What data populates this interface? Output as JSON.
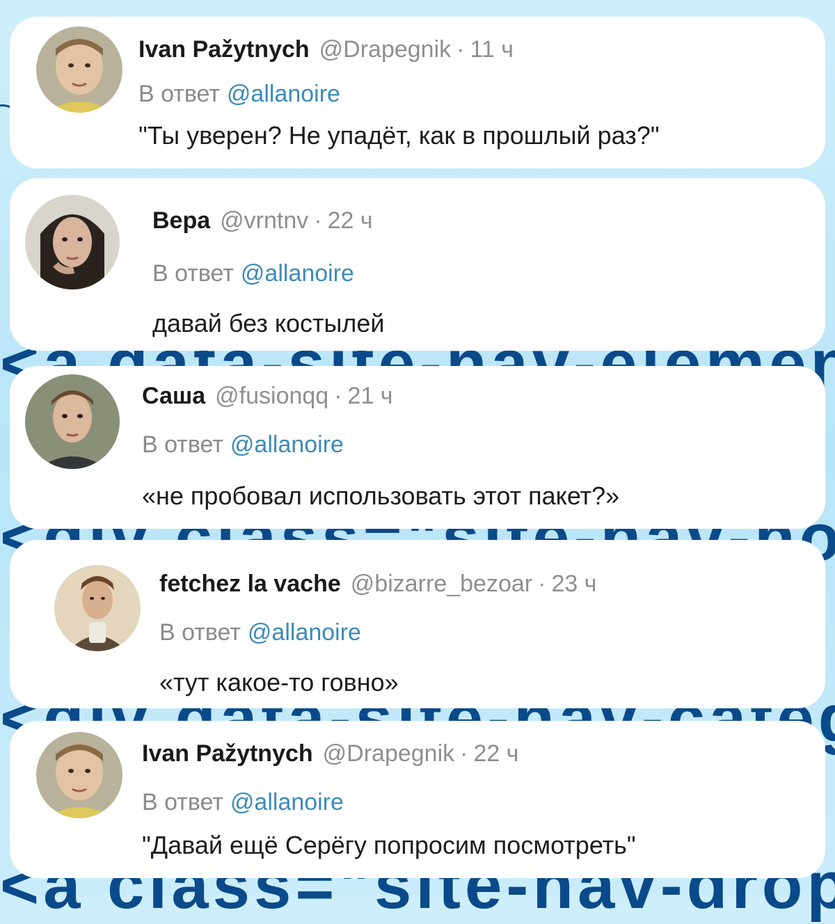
{
  "reply_prefix": "В ответ",
  "replies": [
    {
      "name": "Ivan Pažytnych",
      "handle": "@Drapegnik",
      "separator": "·",
      "time": "11 ч",
      "reply_to": "@allanoire",
      "text": "\"Ты уверен? Не упадёт, как в прошлый раз?\""
    },
    {
      "name": "Вера",
      "handle": "@vrntnv",
      "separator": "·",
      "time": "22 ч",
      "reply_to": "@allanoire",
      "text": "давай без костылей"
    },
    {
      "name": "Саша",
      "handle": "@fusionqq",
      "separator": "·",
      "time": "21 ч",
      "reply_to": "@allanoire",
      "text": "«не пробовал использовать этот пакет?»"
    },
    {
      "name": "fetchez la vache",
      "handle": "@bizarre_bezoar",
      "separator": "·",
      "time": "23 ч",
      "reply_to": "@allanoire",
      "text": "«тут какое-то говно»"
    },
    {
      "name": "Ivan Pažytnych",
      "handle": "@Drapegnik",
      "separator": "·",
      "time": "22 ч",
      "reply_to": "@allanoire",
      "text": "\"Давай ещё Серёгу попросим посмотреть\""
    }
  ],
  "background_code": [
    "<a data-site-nav-element=\"",
    "<div class=\"site-nav-hover-",
    "<div data-site-nav-catego",
    "<a class=\"site-nav-drop"
  ],
  "colors": {
    "background": "#c5ebfa",
    "card": "#ffffff",
    "name": "#1a1a1a",
    "meta": "#8f8f8f",
    "link": "#3a8bb8",
    "body_text": "#1c1c1c",
    "bg_code": "#0a4a8a"
  }
}
